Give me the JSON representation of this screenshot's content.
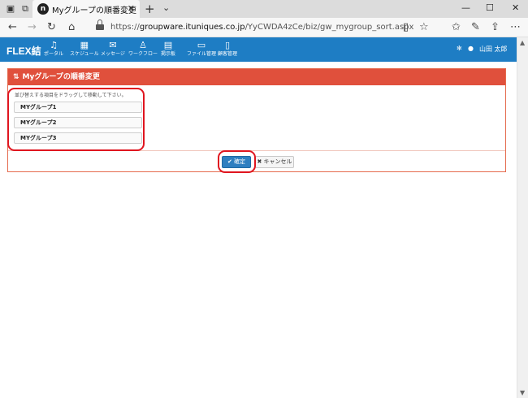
{
  "browser": {
    "tab_title": "Myグループの順番変更",
    "url_prefix": "https://",
    "url_host": "groupware.ituniques.co.jp",
    "url_path": "/YyCWDA4zCe/biz/gw_mygroup_sort.aspx"
  },
  "app": {
    "brand": "FLEX結",
    "menu": [
      {
        "label": "ポータル",
        "icon": "bell-icon"
      },
      {
        "label": "スケジュール",
        "icon": "calendar-icon"
      },
      {
        "label": "メッセージ",
        "icon": "envelope-icon"
      },
      {
        "label": "ワークフロー",
        "icon": "stamp-icon"
      },
      {
        "label": "掲示板",
        "icon": "board-icon"
      },
      {
        "label": "ファイル管理",
        "icon": "folder-icon"
      },
      {
        "label": "顧客管理",
        "icon": "document-icon"
      }
    ],
    "user_name": "山田 太郎"
  },
  "panel": {
    "title": "Myグループの順番変更",
    "instruction": "並び替えする項目をドラッグして移動して下さい。",
    "groups": [
      "MYグループ1",
      "MYグループ2",
      "MYグループ3"
    ],
    "confirm_label": "確定",
    "cancel_label": "キャンセル"
  },
  "colors": {
    "header_blue": "#1e7dc4",
    "panel_red": "#e0503c",
    "confirm_blue": "#2f7fc0",
    "highlight": "#e0151f"
  }
}
